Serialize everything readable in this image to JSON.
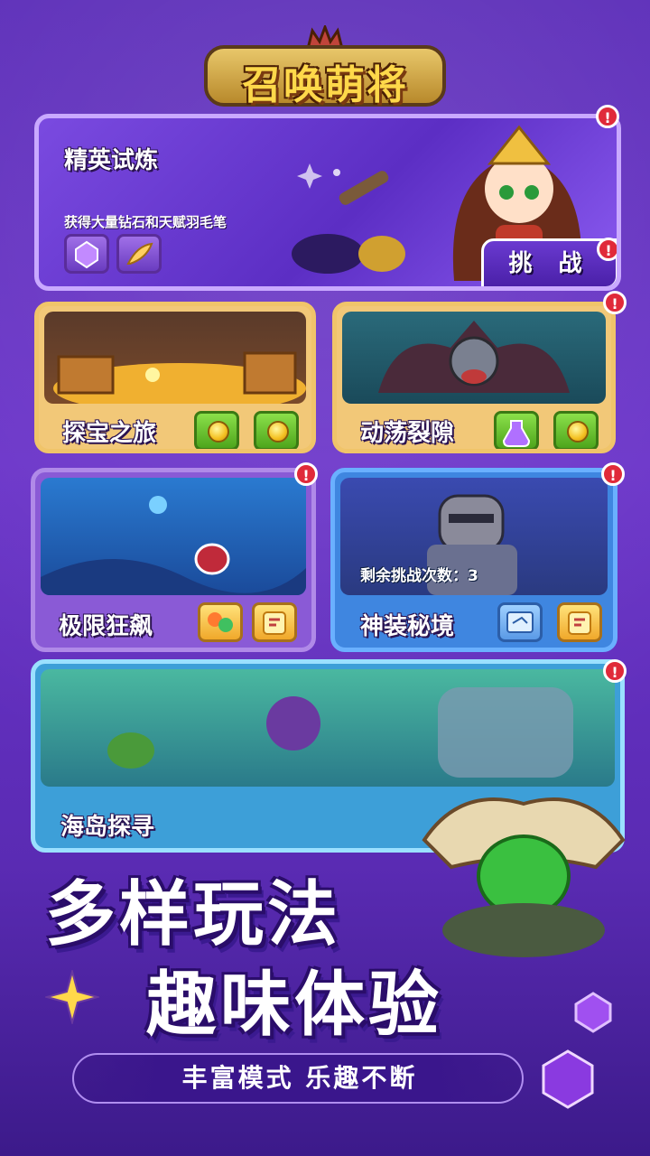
{
  "game": {
    "title": "召唤萌将"
  },
  "modes": {
    "elite": {
      "title": "精英试炼",
      "description": "获得大量钻石和天赋羽毛笔",
      "button": "挑 战",
      "badge": "!"
    },
    "treasure": {
      "title": "探宝之旅"
    },
    "rift": {
      "title": "动荡裂隙",
      "badge": "!"
    },
    "extreme": {
      "title": "极限狂飙",
      "badge": "!"
    },
    "divine": {
      "title": "神装秘境",
      "remaining_label": "剩余挑战次数：3",
      "badge": "!"
    },
    "island": {
      "title": "海岛探寻",
      "badge": "!"
    }
  },
  "slogan": {
    "line1": "多样玩法",
    "line2": "趣味体验",
    "banner": "丰富模式  乐趣不断"
  },
  "colors": {
    "accent": "#ffd84a",
    "badge": "#e02a3a",
    "background": "#5b2cb8"
  }
}
